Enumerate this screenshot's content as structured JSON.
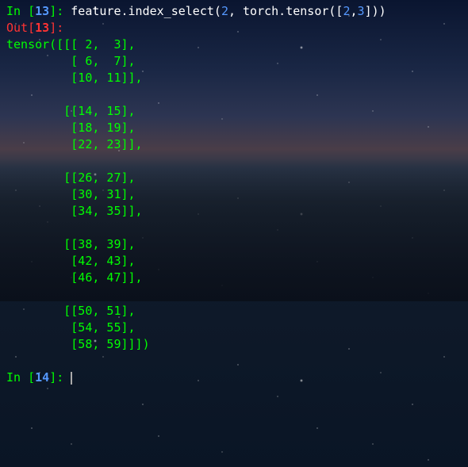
{
  "cells": {
    "in13": {
      "prompt_in": "In [",
      "num": "13",
      "prompt_close": "]: ",
      "code_pre": "feature.index_select(",
      "arg1": "2",
      "sep1": ", torch.tensor([",
      "arg2a": "2",
      "arg2sep": ",",
      "arg2b": "3",
      "code_post": "]))"
    },
    "out13": {
      "prompt_out": "Out[",
      "num": "13",
      "prompt_close": "]:",
      "output": "tensor([[[ 2,  3],\n         [ 6,  7],\n         [10, 11]],\n\n        [[14, 15],\n         [18, 19],\n         [22, 23]],\n\n        [[26, 27],\n         [30, 31],\n         [34, 35]],\n\n        [[38, 39],\n         [42, 43],\n         [46, 47]],\n\n        [[50, 51],\n         [54, 55],\n         [58, 59]]])"
    },
    "in14": {
      "prompt_in": "In [",
      "num": "14",
      "prompt_close": "]: "
    }
  }
}
